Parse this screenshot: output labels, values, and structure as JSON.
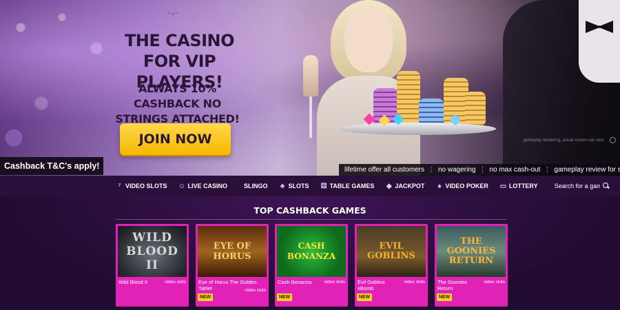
{
  "hero": {
    "title": "THE CASINO FOR VIP PLAYERS!",
    "subtitle": "ALWAYS 10% CASHBACK NO STRINGS ATTACHED!",
    "cta_label": "JOIN NOW",
    "tc_badge": "Cashback T&C's apply!",
    "image_note": "gameplay rendering, actual screen can vary",
    "terms": [
      "lifetime offer all customers",
      "no wagering",
      "no max cash-out",
      "gameplay review for strategic or abusive play"
    ]
  },
  "nav": {
    "items": [
      {
        "label": "VIDEO SLOTS",
        "icon": "777-icon"
      },
      {
        "label": "LIVE CASINO",
        "icon": "dealer-icon"
      },
      {
        "label": "SLINGO",
        "icon": ""
      },
      {
        "label": "SLOTS",
        "icon": "cherry-icon"
      },
      {
        "label": "TABLE GAMES",
        "icon": "dice-icon"
      },
      {
        "label": "JACKPOT",
        "icon": "diamond-icon"
      },
      {
        "label": "VIDEO POKER",
        "icon": "cards-icon"
      },
      {
        "label": "LOTTERY",
        "icon": "ticket-icon"
      }
    ],
    "search_placeholder": "Search for a game"
  },
  "section": {
    "title": "TOP CASHBACK GAMES"
  },
  "games": [
    {
      "name": "Wild Blood II",
      "category": "video slots",
      "art": "WILD BLOOD II",
      "new": false
    },
    {
      "name": "Eye of Horus The Golden Tablet",
      "category": "video slots",
      "art": "EYE OF HORUS",
      "new": true,
      "badge": "NEW"
    },
    {
      "name": "Cash Bonanza",
      "category": "video slots",
      "art": "CASH BONANZA",
      "new": true,
      "badge": "NEW"
    },
    {
      "name": "Evil Goblins xBomb",
      "category": "video slots",
      "art": "EVIL GOBLINS",
      "new": true,
      "badge": "NEW"
    },
    {
      "name": "The Goonies Return",
      "category": "video slots",
      "art": "THE GOONIES RETURN",
      "new": true,
      "badge": "NEW"
    }
  ],
  "colors": {
    "accent": "#e222b7",
    "cta": "#f6b800",
    "nav_bg": "#2a0f3a",
    "badge": "#ffd21a"
  }
}
